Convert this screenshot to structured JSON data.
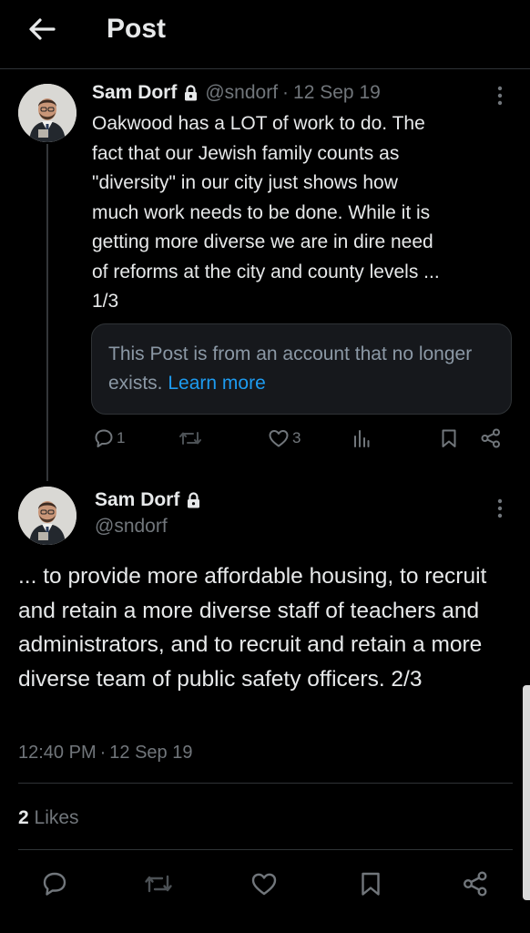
{
  "header": {
    "title": "Post",
    "back_icon": "arrow-left-icon"
  },
  "tweet1": {
    "name": "Sam Dorf",
    "handle": "@sndorf",
    "separator": "·",
    "date": "12 Sep 19",
    "text": "Oakwood has a LOT of work to do. The\nfact that our Jewish family counts as\n\"diversity\" in our city just shows how\nmuch work needs to be done. While it is\ngetting more diverse we are in dire need\nof reforms at the city and county levels ...\n1/3",
    "quote_notice": "This Post is from an account that no longer exists.",
    "quote_link": "Learn more",
    "actions": {
      "replies": "1",
      "reposts": "",
      "likes": "3",
      "views": ""
    }
  },
  "tweet2": {
    "name": "Sam Dorf",
    "handle": "@sndorf",
    "text": "... to provide more affordable housing, to recruit and retain a more diverse staff of teachers and administrators, and to recruit and retain a more diverse team of public safety officers. 2/3",
    "time": "12:40 PM",
    "separator": "·",
    "date": "12 Sep 19",
    "likes_count": "2",
    "likes_label": "Likes"
  },
  "colors": {
    "background": "#000000",
    "text": "#e7e9ea",
    "secondary": "#71767b",
    "link": "#1d9bf0",
    "border": "#2f3336"
  }
}
